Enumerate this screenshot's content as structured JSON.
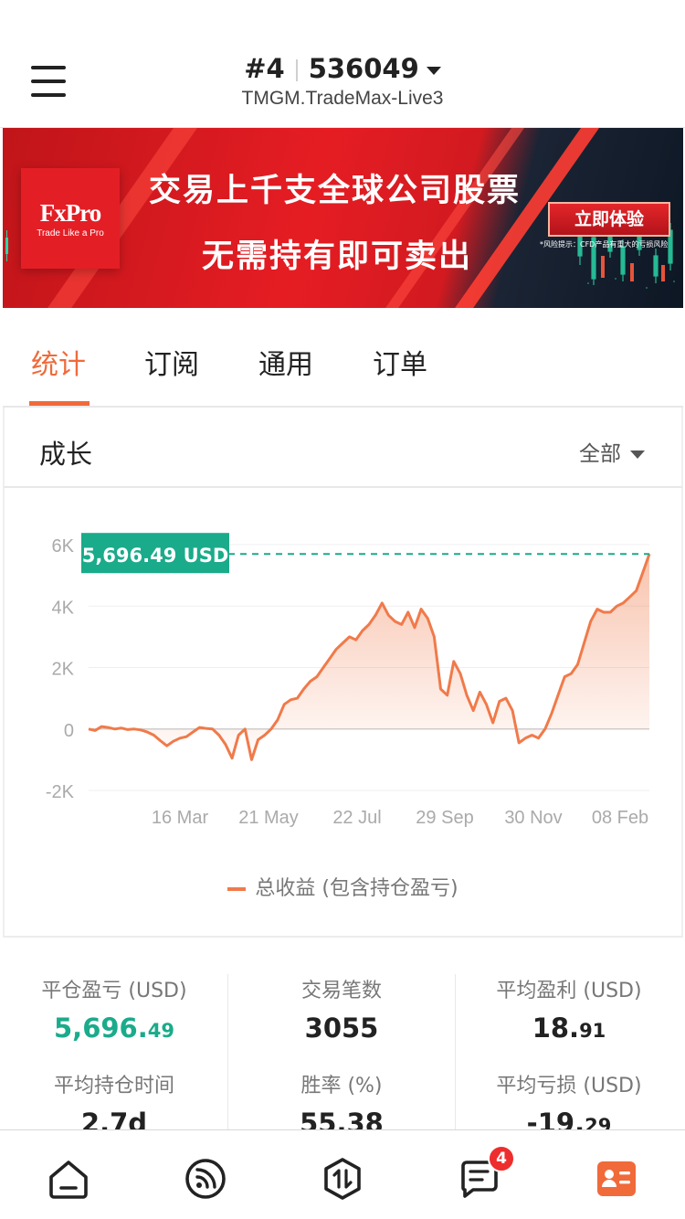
{
  "header": {
    "account_number": "#4",
    "account_id": "536049",
    "server": "TMGM.TradeMax-Live3"
  },
  "banner": {
    "brand": "FxPro",
    "tagline": "Trade Like a Pro",
    "headline_1": "交易上千支全球公司股票",
    "headline_2": "无需持有即可卖出",
    "cta": "立即体验",
    "fine_print": "*风险提示：CFD产品有重大的亏损风险"
  },
  "tabs": [
    {
      "label": "统计",
      "active": true
    },
    {
      "label": "订阅",
      "active": false
    },
    {
      "label": "通用",
      "active": false
    },
    {
      "label": "订单",
      "active": false
    }
  ],
  "growth": {
    "title": "成长",
    "period": "全部"
  },
  "chart_data": {
    "type": "area",
    "ylim": [
      -2000,
      6000
    ],
    "y_ticks": [
      "6K",
      "4K",
      "2K",
      "0",
      "-2K"
    ],
    "x_ticks": [
      "16 Mar",
      "21 May",
      "22 Jul",
      "29 Sep",
      "30 Nov",
      "08 Feb"
    ],
    "current_value_label": "5,696.49 USD",
    "current_value": 5696.49,
    "series": [
      {
        "name": "总收益 (包含持仓盈亏)",
        "color": "#f07a4a",
        "values": [
          0,
          -50,
          80,
          50,
          0,
          30,
          -20,
          0,
          -30,
          -100,
          -200,
          -380,
          -550,
          -400,
          -300,
          -250,
          -100,
          50,
          20,
          0,
          -200,
          -500,
          -950,
          -200,
          0,
          -1000,
          -350,
          -200,
          0,
          300,
          800,
          950,
          1000,
          1300,
          1550,
          1700,
          2000,
          2300,
          2600,
          2800,
          3000,
          2900,
          3200,
          3400,
          3700,
          4100,
          3700,
          3500,
          3400,
          3800,
          3300,
          3900,
          3600,
          3000,
          1300,
          1100,
          2200,
          1800,
          1100,
          600,
          1200,
          800,
          200,
          900,
          1000,
          600,
          -450,
          -300,
          -200,
          -300,
          0,
          500,
          1100,
          1700,
          1800,
          2100,
          2800,
          3500,
          3900,
          3800,
          3800,
          4000,
          4100,
          4300,
          4500,
          5100,
          5696.49
        ]
      }
    ],
    "grid": true
  },
  "stats": [
    {
      "label": "平仓盈亏 (USD)",
      "value_main": "5,696.",
      "value_dec": "49",
      "highlight": true
    },
    {
      "label": "交易笔数",
      "value_main": "3055",
      "value_dec": "",
      "highlight": false
    },
    {
      "label": "平均盈利 (USD)",
      "value_main": "18.",
      "value_dec": "91",
      "highlight": false
    },
    {
      "label": "平均持仓时间",
      "value_main": "2.7d",
      "value_dec": "",
      "highlight": false
    },
    {
      "label": "胜率 (%)",
      "value_main": "55.38",
      "value_dec": "",
      "highlight": false
    },
    {
      "label": "平均亏损 (USD)",
      "value_main": "-19.",
      "value_dec": "29",
      "highlight": false
    }
  ],
  "nav": {
    "items": [
      "home-icon",
      "feed-icon",
      "trade-icon",
      "messages-icon",
      "profile-card-icon"
    ],
    "badge_count": "4",
    "accent": "#f06a3a"
  }
}
